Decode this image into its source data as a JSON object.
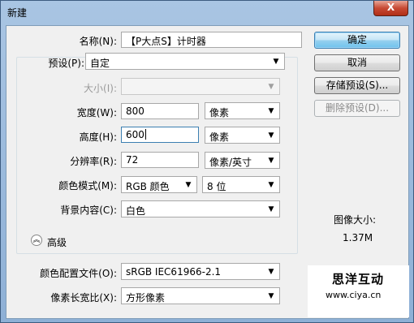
{
  "window": {
    "title": "新建",
    "close_glyph": "X"
  },
  "form": {
    "name": {
      "label": "名称(N):",
      "value": "【P大点S】计时器"
    },
    "preset": {
      "label": "预设(P):",
      "value": "自定"
    },
    "size": {
      "label": "大小(I):",
      "value": ""
    },
    "width": {
      "label": "宽度(W):",
      "value": "800",
      "unit": "像素"
    },
    "height": {
      "label": "高度(H):",
      "value": "600",
      "unit": "像素"
    },
    "resolution": {
      "label": "分辨率(R):",
      "value": "72",
      "unit": "像素/英寸"
    },
    "color_mode": {
      "label": "颜色模式(M):",
      "value": "RGB 颜色",
      "depth": "8 位"
    },
    "background": {
      "label": "背景内容(C):",
      "value": "白色"
    },
    "advanced": {
      "label": "高级",
      "icon": "chevron-up-double-icon"
    },
    "color_profile": {
      "label": "颜色配置文件(O):",
      "value": "sRGB IEC61966-2.1"
    },
    "pixel_aspect": {
      "label": "像素长宽比(X):",
      "value": "方形像素"
    }
  },
  "buttons": {
    "ok": "确定",
    "cancel": "取消",
    "save_preset": "存储预设(S)...",
    "delete_preset": "删除预设(D)..."
  },
  "image_size": {
    "label": "图像大小:",
    "value": "1.37M"
  },
  "watermark": {
    "title": "思洋互动",
    "url": "www.ciya.cn"
  },
  "colors": {
    "accent": "#3c7fb1",
    "titlebar": "#a9c5e3",
    "close": "#c74a34"
  }
}
